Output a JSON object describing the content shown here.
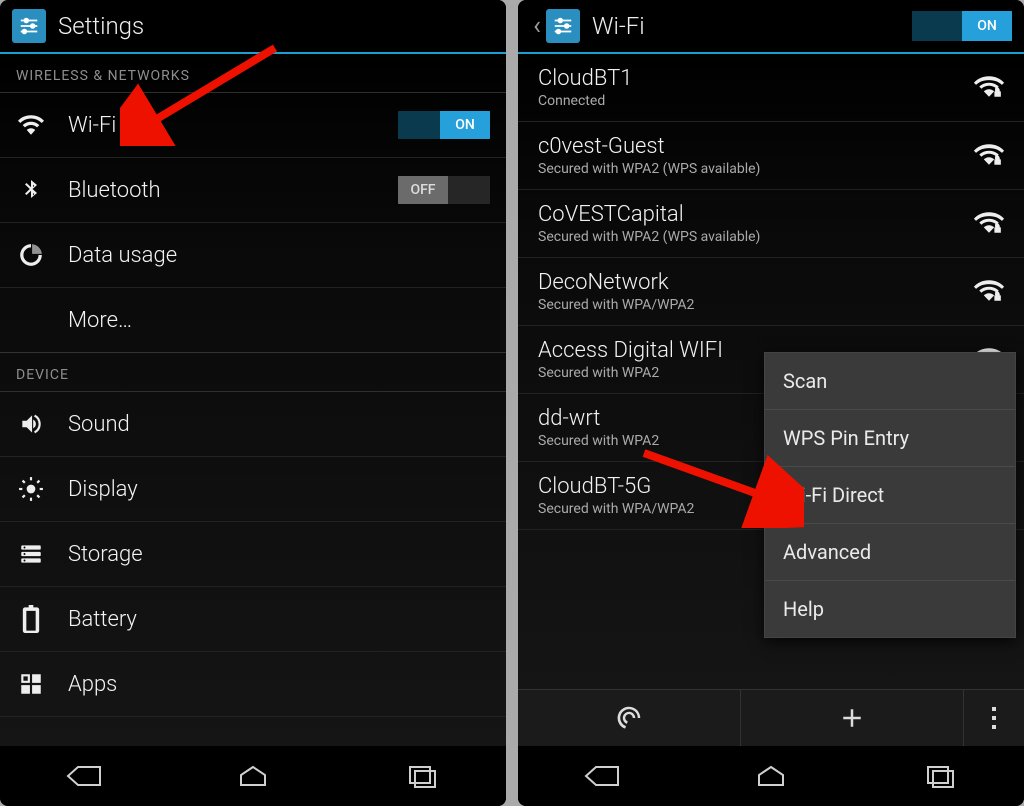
{
  "left": {
    "title": "Settings",
    "sections": {
      "wireless_header": "WIRELESS & NETWORKS",
      "device_header": "DEVICE"
    },
    "wifi": {
      "label": "Wi-Fi",
      "toggle_state": "ON"
    },
    "bluetooth": {
      "label": "Bluetooth",
      "toggle_state": "OFF"
    },
    "data_usage": {
      "label": "Data usage"
    },
    "more": {
      "label": "More…"
    },
    "sound": {
      "label": "Sound"
    },
    "display": {
      "label": "Display"
    },
    "storage": {
      "label": "Storage"
    },
    "battery": {
      "label": "Battery"
    },
    "apps": {
      "label": "Apps"
    }
  },
  "right": {
    "title": "Wi-Fi",
    "toggle_state": "ON",
    "networks": [
      {
        "name": "CloudBT1",
        "sub": "Connected",
        "secured": true
      },
      {
        "name": "c0vest-Guest",
        "sub": "Secured with WPA2 (WPS available)",
        "secured": true
      },
      {
        "name": "CoVESTCapital",
        "sub": "Secured with WPA2 (WPS available)",
        "secured": true
      },
      {
        "name": "DecoNetwork",
        "sub": "Secured with WPA/WPA2",
        "secured": true
      },
      {
        "name": "Access Digital WIFI",
        "sub": "Secured with WPA2",
        "secured": true
      },
      {
        "name": "dd-wrt",
        "sub": "Secured with WPA2",
        "secured": true
      },
      {
        "name": "CloudBT-5G",
        "sub": "Secured with WPA/WPA2",
        "secured": true
      }
    ],
    "menu": {
      "scan": "Scan",
      "wps": "WPS Pin Entry",
      "direct": "Wi-Fi Direct",
      "advanced": "Advanced",
      "help": "Help"
    }
  }
}
